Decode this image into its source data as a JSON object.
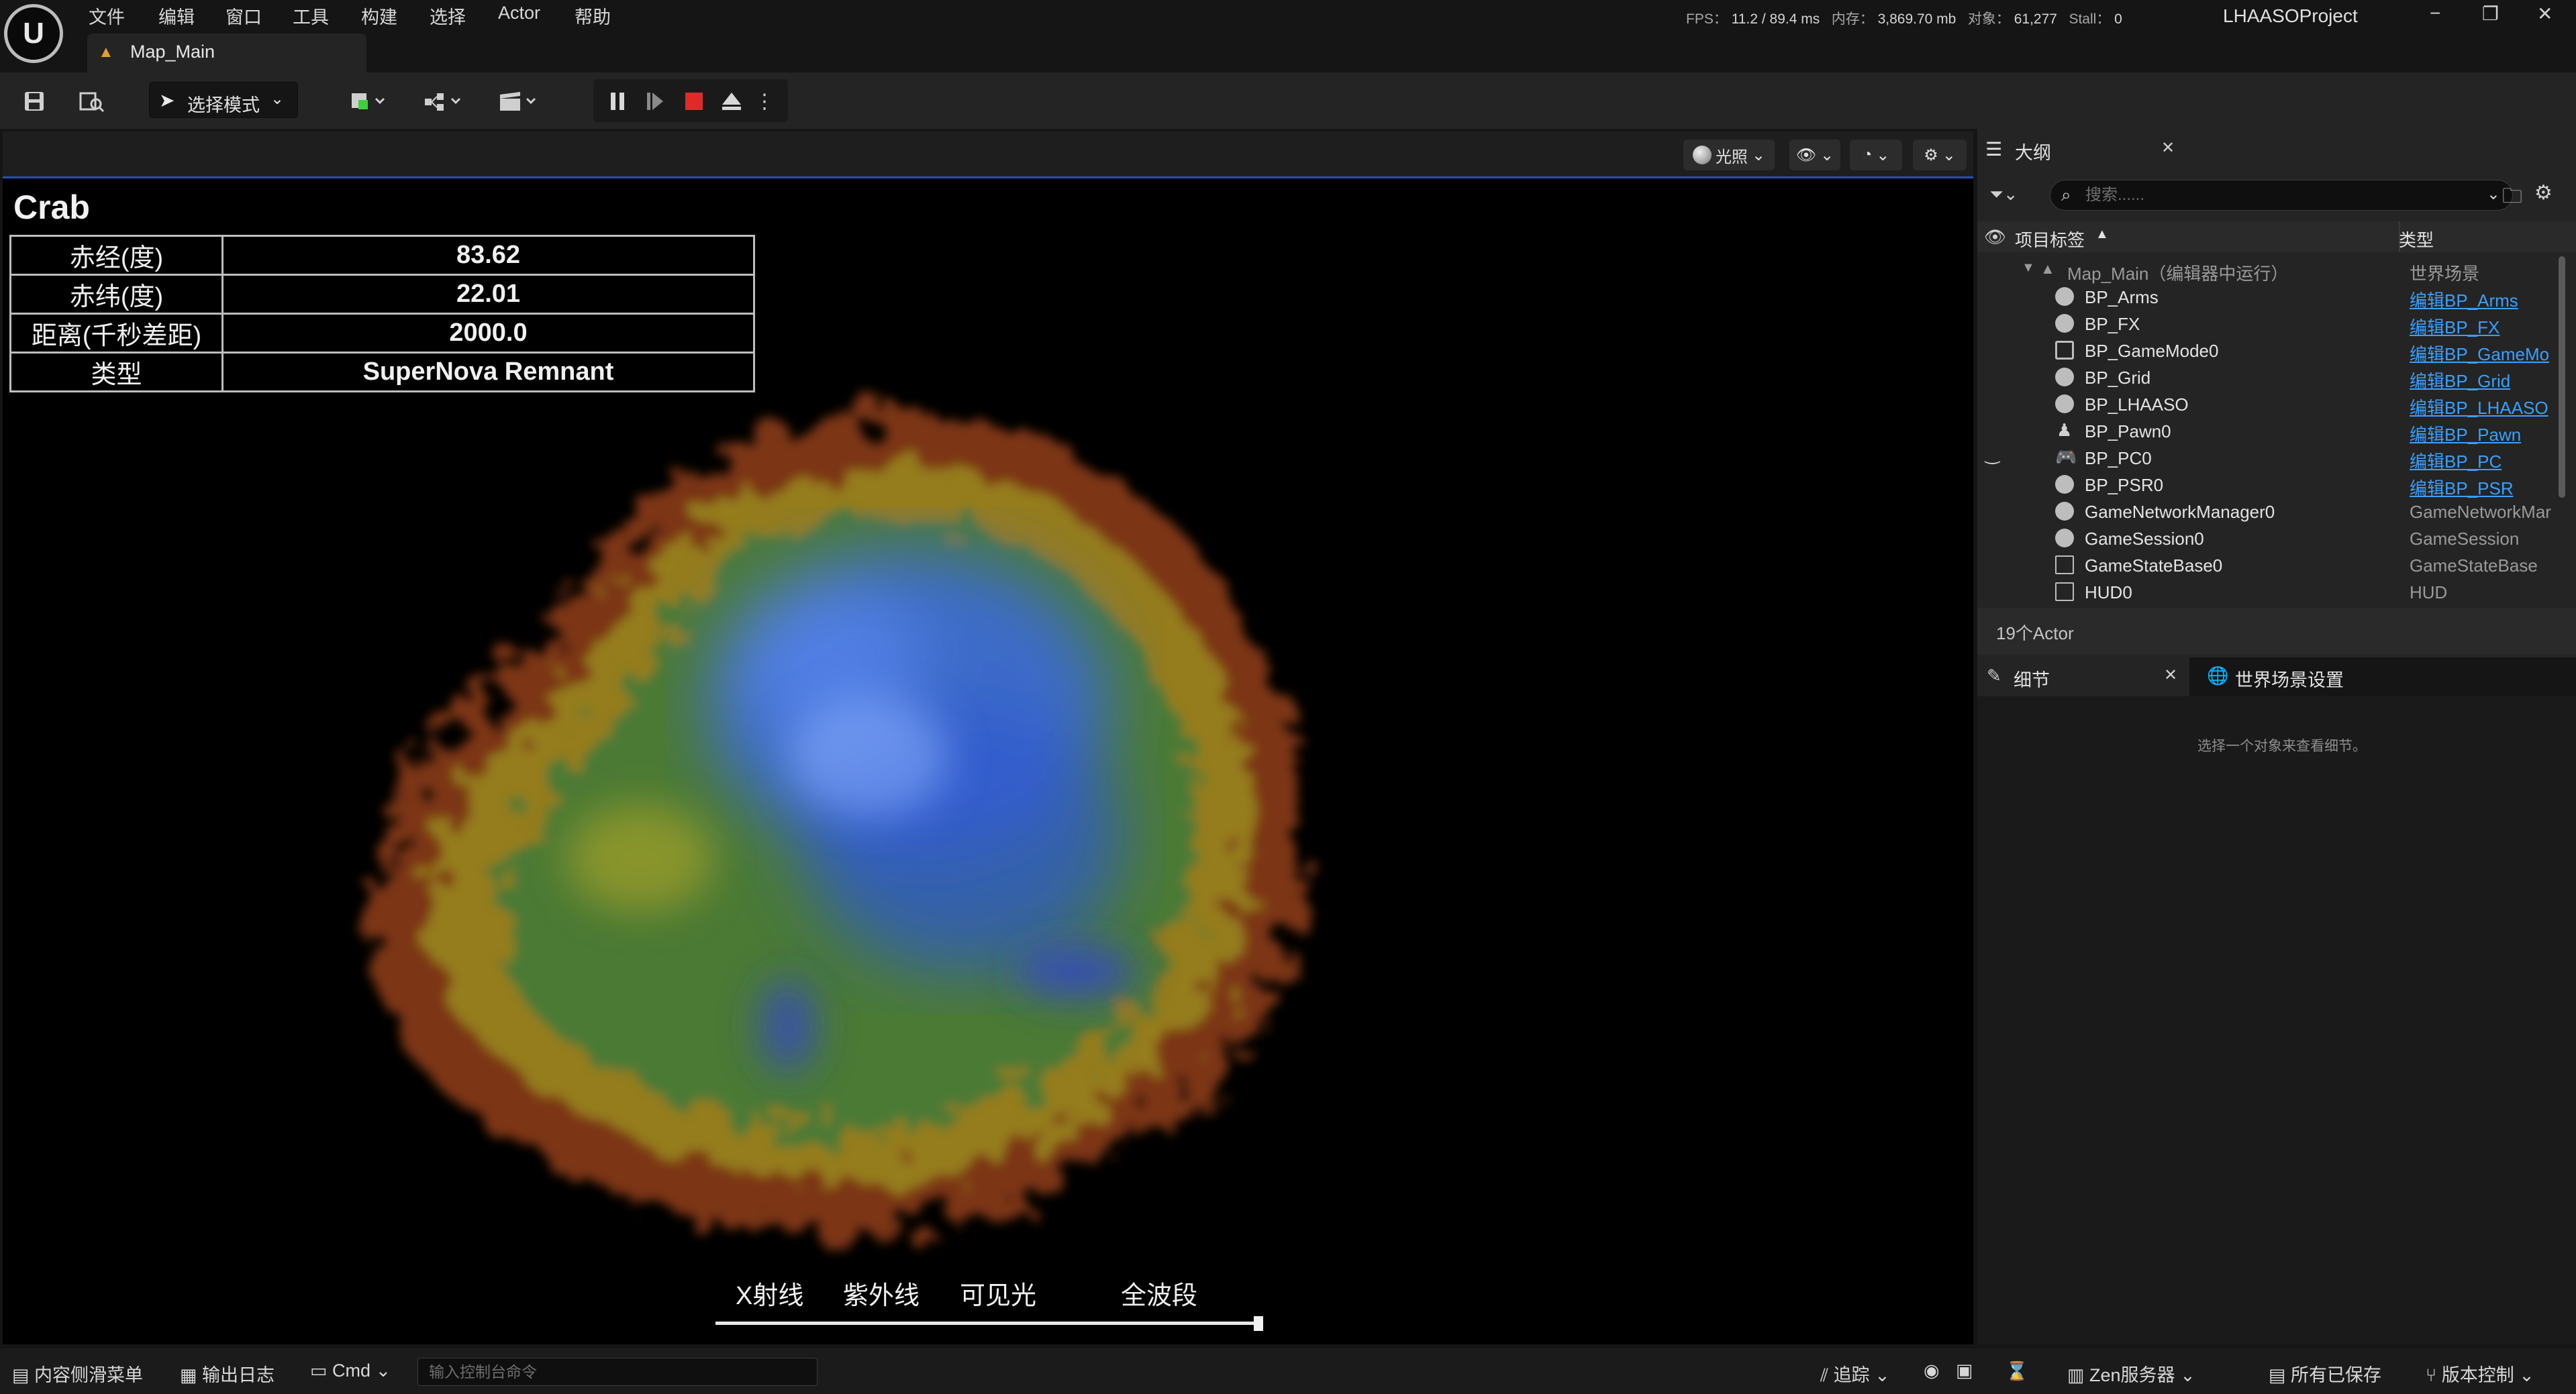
{
  "app": {
    "menu": [
      "文件",
      "编辑",
      "窗口",
      "工具",
      "构建",
      "选择",
      "Actor",
      "帮助"
    ],
    "map_tab": "Map_Main",
    "project": "LHAASOProject"
  },
  "stats": {
    "fps_label": "FPS：",
    "fps": "11.2",
    "ms": "/ 89.4 ms",
    "mem_label": "内存：",
    "mem": "3,869.70 mb",
    "obj_label": "对象：",
    "obj": "61,277",
    "stall_label": "Stall：",
    "stall": "0"
  },
  "toolbar": {
    "mode_label": "选择模式"
  },
  "viewport": {
    "lighting_label": "光照",
    "object_name": "Crab",
    "info_rows": [
      {
        "key": "赤经(度)",
        "value": "83.62"
      },
      {
        "key": "赤纬(度)",
        "value": "22.01"
      },
      {
        "key": "距离(千秒差距)",
        "value": "2000.0"
      },
      {
        "key": "类型",
        "value": "SuperNova Remnant"
      }
    ],
    "bands": [
      "X射线",
      "紫外线",
      "可见光",
      "全波段"
    ],
    "slider_position": 1.0
  },
  "outliner": {
    "title": "大纲",
    "search_placeholder": "搜索......",
    "col_label": "项目标签",
    "col_type": "类型",
    "root_name": "Map_Main（编辑器中运行）",
    "root_type": "世界场景",
    "rows": [
      {
        "name": "BP_Arms",
        "type": "编辑BP_Arms",
        "link": true
      },
      {
        "name": "BP_FX",
        "type": "编辑BP_FX",
        "link": true
      },
      {
        "name": "BP_GameMode0",
        "type": "编辑BP_GameMo",
        "link": true
      },
      {
        "name": "BP_Grid",
        "type": "编辑BP_Grid",
        "link": true
      },
      {
        "name": "BP_LHAASO",
        "type": "编辑BP_LHAASO",
        "link": true
      },
      {
        "name": "BP_Pawn0",
        "type": "编辑BP_Pawn",
        "link": true
      },
      {
        "name": "BP_PC0",
        "type": "编辑BP_PC",
        "link": true
      },
      {
        "name": "BP_PSR0",
        "type": "编辑BP_PSR",
        "link": true
      },
      {
        "name": "GameNetworkManager0",
        "type": "GameNetworkMar",
        "link": false
      },
      {
        "name": "GameSession0",
        "type": "GameSession",
        "link": false
      },
      {
        "name": "GameStateBase0",
        "type": "GameStateBase",
        "link": false
      },
      {
        "name": "HUD0",
        "type": "HUD",
        "link": false
      }
    ],
    "actor_count": "19个Actor"
  },
  "details": {
    "tab_details": "细节",
    "tab_world": "世界场景设置",
    "hint": "选择一个对象来查看细节。"
  },
  "statusbar": {
    "content_drawer": "内容侧滑菜单",
    "output_log": "输出日志",
    "cmd": "Cmd",
    "cmd_placeholder": "输入控制台命令",
    "trace": "追踪",
    "zen": "Zen服务器",
    "all_saved": "所有已保存",
    "source_control": "版本控制"
  }
}
